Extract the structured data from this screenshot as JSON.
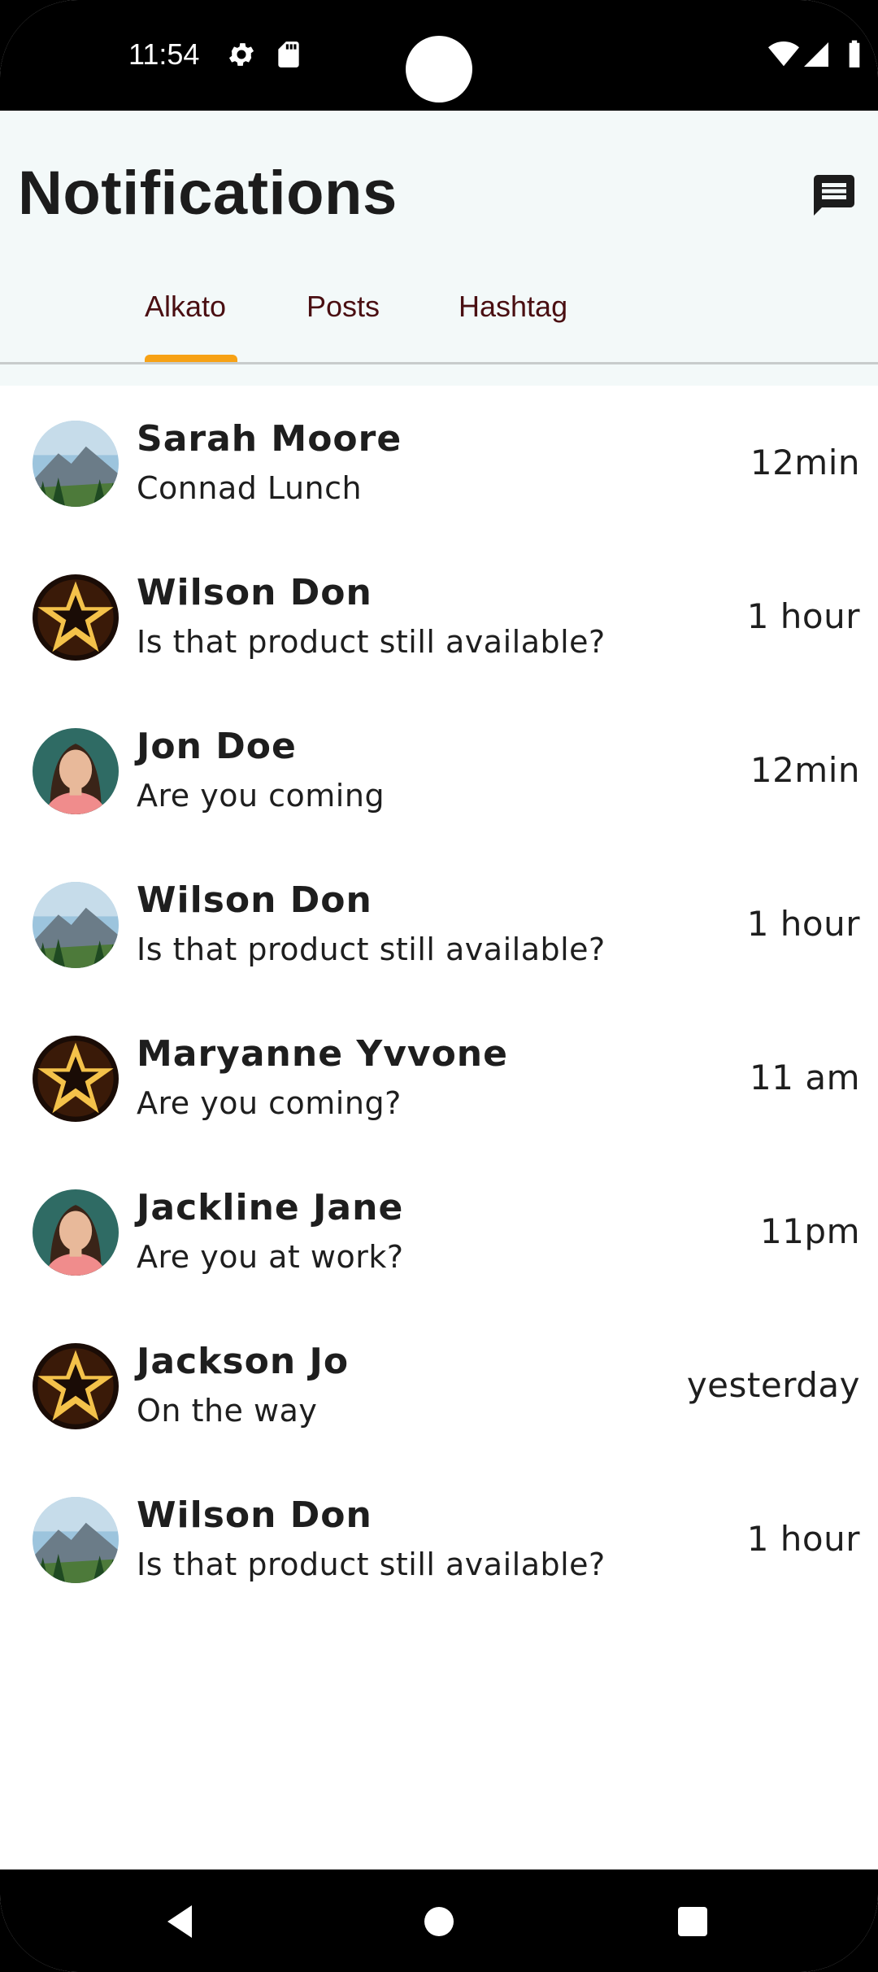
{
  "status_bar": {
    "time": "11:54",
    "icons": [
      "gear-icon",
      "sd-card-icon",
      "wifi-icon",
      "signal-icon",
      "battery-icon"
    ]
  },
  "header": {
    "title": "Notifications",
    "action_icon": "chat-icon"
  },
  "tabs": [
    {
      "label": "Alkato",
      "active": true
    },
    {
      "label": "Posts",
      "active": false
    },
    {
      "label": "Hashtag",
      "active": false
    }
  ],
  "colors": {
    "accent": "#f7a215",
    "tab_text": "#4a0f12",
    "header_bg": "#f3f9f9"
  },
  "notifications": [
    {
      "name": "Sarah Moore",
      "message": "Connad Lunch",
      "time": "12min",
      "avatar": "mountain"
    },
    {
      "name": "Wilson Don",
      "message": "Is that product still available?",
      "time": "1 hour",
      "avatar": "star"
    },
    {
      "name": "Jon Doe",
      "message": "Are you coming",
      "time": "12min",
      "avatar": "woman"
    },
    {
      "name": "Wilson Don",
      "message": "Is that product still available?",
      "time": "1 hour",
      "avatar": "mountain"
    },
    {
      "name": "Maryanne Yvvone",
      "message": "Are you coming?",
      "time": "11 am",
      "avatar": "star"
    },
    {
      "name": "Jackline Jane",
      "message": "Are you at work?",
      "time": "11pm",
      "avatar": "woman"
    },
    {
      "name": "Jackson Jo",
      "message": "On the way",
      "time": "yesterday",
      "avatar": "star"
    },
    {
      "name": "Wilson Don",
      "message": "Is that product still available?",
      "time": "1 hour",
      "avatar": "mountain"
    }
  ],
  "nav_bar": {
    "buttons": [
      "back-icon",
      "home-icon",
      "recents-icon"
    ]
  }
}
